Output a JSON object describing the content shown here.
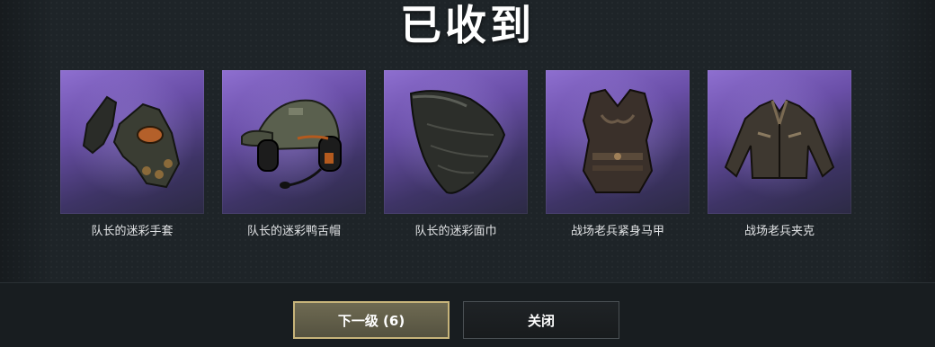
{
  "title": "已收到",
  "rewards": [
    {
      "name": "队长的迷彩手套",
      "icon": "gloves-icon"
    },
    {
      "name": "队长的迷彩鸭舌帽",
      "icon": "cap-with-headset-icon"
    },
    {
      "name": "队长的迷彩面巾",
      "icon": "face-mask-icon"
    },
    {
      "name": "战场老兵紧身马甲",
      "icon": "vest-icon"
    },
    {
      "name": "战场老兵夹克",
      "icon": "jacket-icon"
    }
  ],
  "buttons": {
    "next_label": "下一级 (6)",
    "close_label": "关闭"
  },
  "colors": {
    "tile_purple": "#6a4fa8",
    "next_border": "#c7b47a",
    "background": "#1e2428"
  }
}
